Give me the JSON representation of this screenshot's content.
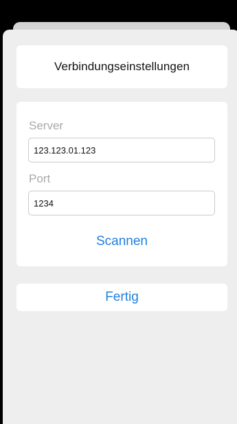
{
  "dialog": {
    "title": "Verbindungseinstellungen"
  },
  "form": {
    "server": {
      "label": "Server",
      "value": "123.123.01.123"
    },
    "port": {
      "label": "Port",
      "value": "1234"
    },
    "scan_label": "Scannen"
  },
  "actions": {
    "done_label": "Fertig"
  },
  "colors": {
    "accent": "#1e7fe0",
    "label_gray": "#a9a9a9",
    "sheet_background": "#eeeeee",
    "card_background": "#ffffff"
  }
}
